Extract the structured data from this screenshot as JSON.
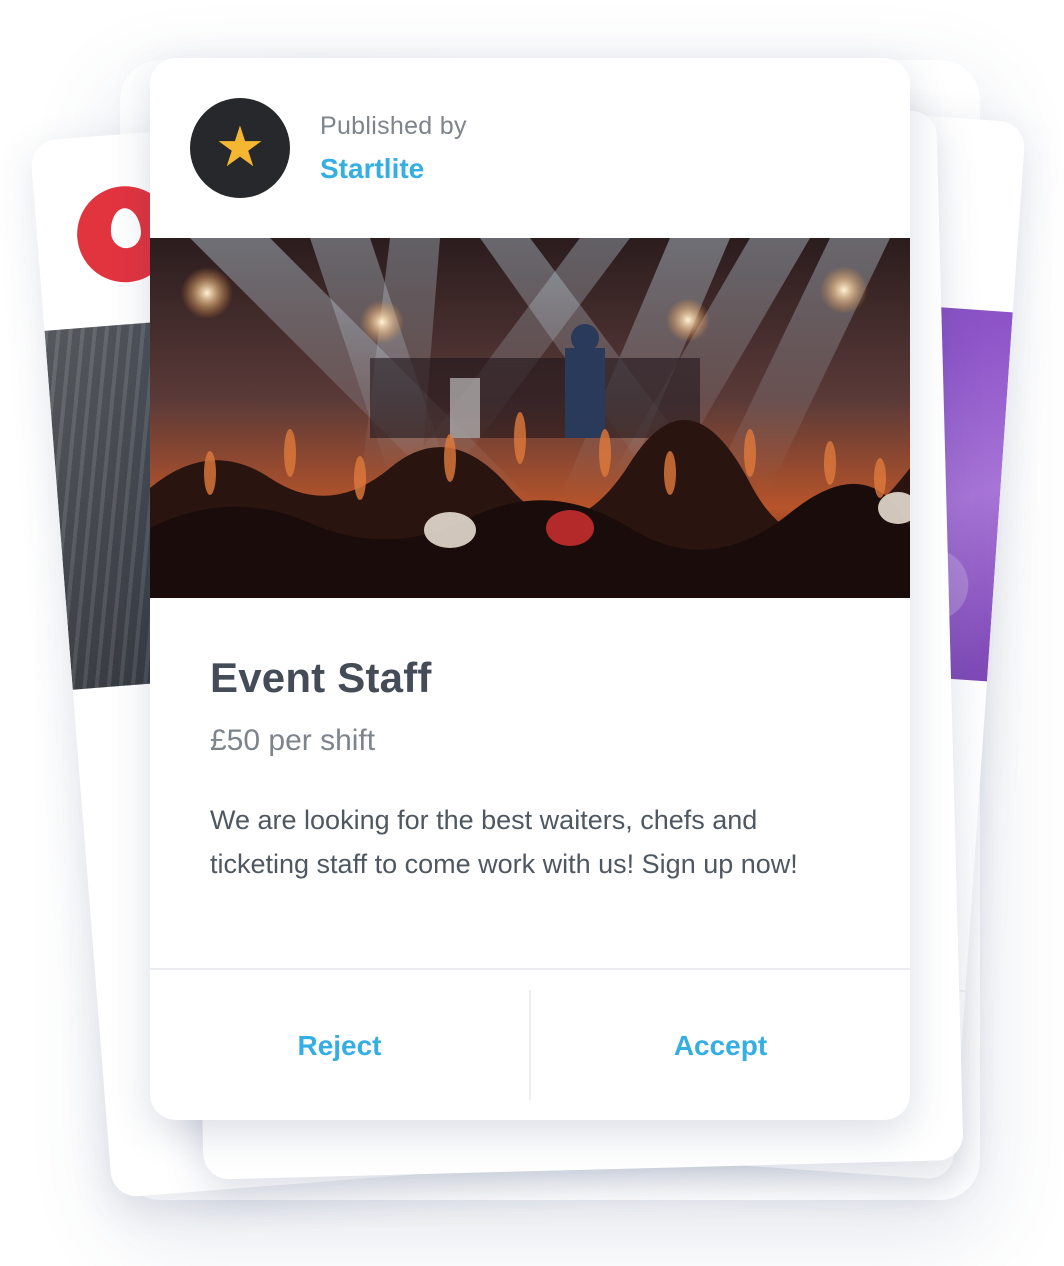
{
  "publisher": {
    "label": "Published by",
    "name": "Startlite",
    "avatar_icon": "star-icon",
    "avatar_color": "#26282b",
    "star_color": "#f5b731"
  },
  "job": {
    "title": "Event Staff",
    "pay": "£50 per shift",
    "description": "We are looking for the best waiters, chefs and ticketing staff  to come work with us! Sign up now!"
  },
  "actions": {
    "reject_label": "Reject",
    "accept_label": "Accept"
  },
  "colors": {
    "accent": "#34aee3",
    "title_text": "#434c57",
    "muted_text": "#7d848c"
  }
}
